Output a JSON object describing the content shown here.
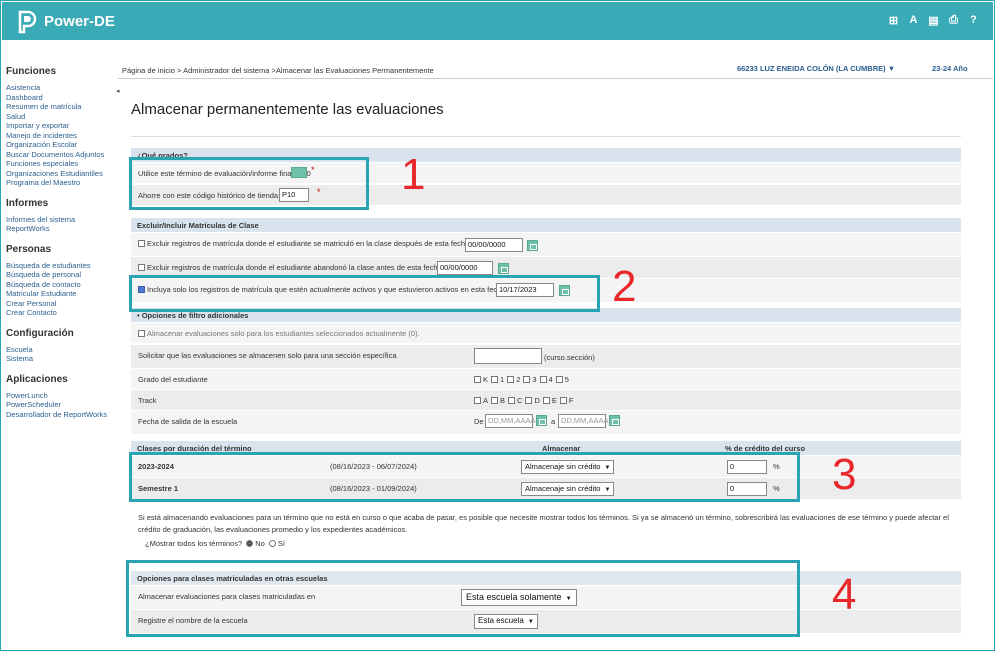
{
  "app": {
    "brand": "Power-DE",
    "icons": [
      "grid-icon",
      "text-icon",
      "file-icon",
      "print-icon",
      "help-icon"
    ]
  },
  "breadcrumb": "Página de inicio > Administrador del sistema >Almacenar las Evaluaciones Permanentemente",
  "user": "66233 LUZ ENEIDA COLÓN (LA CUMBRE)",
  "term": "23-24 Año",
  "page_title": "Almacenar permanentemente las evaluaciones",
  "sidebar": {
    "funciones_title": "Funciones",
    "funciones": [
      "Asistencia",
      "Dashboard",
      "Resumen de matrícula",
      "Salud",
      "Importar y exportar",
      "Manejo de incidentes",
      "Organización Escolar",
      "Buscar Documentos Adjuntos",
      "Funciones especiales",
      "Organizaciones Estudiantiles",
      "Programa del Maestro"
    ],
    "informes_title": "Informes",
    "informes": [
      "Informes del sistema",
      "ReportWorks"
    ],
    "personas_title": "Personas",
    "personas": [
      "Búsqueda de estudiantes",
      "Búsqueda de personal",
      "Búsqueda de contacto",
      "Matricular Estudiante",
      "Crear Personal",
      "Crear Contacto"
    ],
    "config_title": "Configuración",
    "config": [
      "Escuela",
      "Sistema"
    ],
    "apps_title": "Aplicaciones",
    "apps": [
      "PowerLunch",
      "PowerScheduler",
      "Desarrollador de ReportWorks"
    ]
  },
  "grados": {
    "title": "¿Qué grados?",
    "term_label": "Utilice este término de evaluación/informe final:",
    "term_value": "P10",
    "store_label": "Ahorre con este código histórico de tienda:",
    "store_value": "P10"
  },
  "excluir": {
    "title": "Excluir/Incluir Matrículas de Clase",
    "opt1": "Excluir registros de matrícula donde el estudiante se matriculó en la clase después de esta fecha:",
    "opt1_value": "00/00/0000",
    "opt2": "Excluir registros de matrícula donde el estudiante abandonó la clase antes de esta fecha:",
    "opt2_value": "00/00/0000",
    "opt3": "Incluya solo los registros de matrícula que estén actualmente activos y que estuvieron activos en esta fecha:",
    "opt3_value": "10/17/2023"
  },
  "filtros": {
    "title": "Opciones de filtro adicionales",
    "sel_only": "Almacenar evaluaciones solo para los estudiantes seleccionados actualmente (0).",
    "section_label": "Solicitar que las evaluaciones se almacenen solo para una sección específica",
    "section_hint": "(curso.sección)",
    "grade_label": "Grado del estudiante",
    "grades": [
      "K",
      "1",
      "2",
      "3",
      "4",
      "5"
    ],
    "track_label": "Track",
    "tracks": [
      "A",
      "B",
      "C",
      "D",
      "E",
      "F"
    ],
    "exit_label": "Fecha de salida de la escuela",
    "de": "De",
    "a": "a",
    "date_placeholder": "DD,MM,AAAA"
  },
  "clases": {
    "title": "Clases por duración del término",
    "col_store": "Almacenar",
    "col_credit": "% de crédito del curso",
    "rows": [
      {
        "name": "2023-2024",
        "range": "(08/16/2023 - 06/07/2024)",
        "store": "Almacenaje sin crédito",
        "credit": "0",
        "pct": "%"
      },
      {
        "name": "Semestre 1",
        "range": "(08/16/2023 - 01/09/2024)",
        "store": "Almacenaje sin crédito",
        "credit": "0",
        "pct": "%"
      }
    ]
  },
  "note": "Si está almacenando evaluaciones para un término que no está en curso o que acaba de pasar, es posible que necesite mostrar todos los términos. Si ya se almacenó un término, sobrescribirá las evaluaciones de ese término y puede afectar el crédito de graduación, las evaluaciones promedio y los expedientes académicos.",
  "show_all": {
    "label": "¿Mostrar todos los términos?",
    "no": "No",
    "si": "Sí"
  },
  "otras": {
    "title": "Opciones para clases matriculadas en otras escuelas",
    "store_label": "Almacenar evaluaciones para clases matriculadas en",
    "store_value": "Esta escuela solamente",
    "name_label": "Registre el nombre de la escuela",
    "name_value": "Esta escuela"
  },
  "callouts": [
    "1",
    "2",
    "3",
    "4"
  ],
  "colors": {
    "teal": "#2aa3b3",
    "callout_red": "#e8272b"
  }
}
